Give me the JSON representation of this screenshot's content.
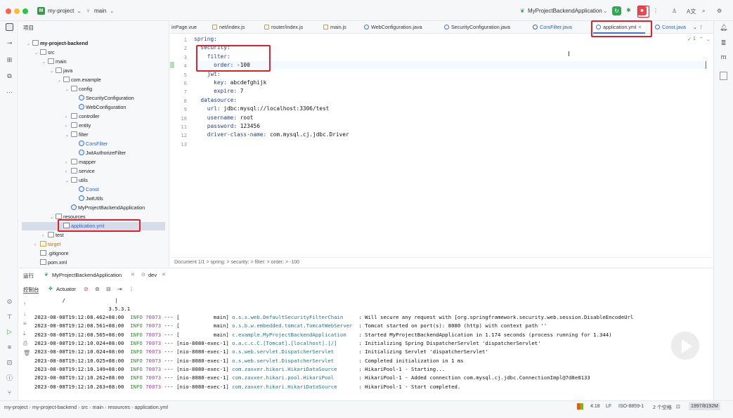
{
  "titlebar": {
    "project_badge": "M",
    "project_name": "my-project",
    "branch": "main",
    "run_config": "MyProjectBackendApplication"
  },
  "project_tree": {
    "header": "项目",
    "items": [
      {
        "label": "my-project-backend",
        "type": "folder",
        "bold": true
      },
      {
        "label": "src",
        "type": "folder"
      },
      {
        "label": "main",
        "type": "folder"
      },
      {
        "label": "java",
        "type": "folder"
      },
      {
        "label": "com.example",
        "type": "package"
      },
      {
        "label": "config",
        "type": "package"
      },
      {
        "label": "SecurityConfiguration",
        "type": "class"
      },
      {
        "label": "WebConfiguration",
        "type": "class"
      },
      {
        "label": "controller",
        "type": "package"
      },
      {
        "label": "entity",
        "type": "package"
      },
      {
        "label": "filter",
        "type": "package"
      },
      {
        "label": "CorsFilter",
        "type": "class"
      },
      {
        "label": "JwtAuthorizeFilter",
        "type": "class"
      },
      {
        "label": "mapper",
        "type": "package"
      },
      {
        "label": "service",
        "type": "package"
      },
      {
        "label": "utils",
        "type": "package"
      },
      {
        "label": "Const",
        "type": "class"
      },
      {
        "label": "JwtUtils",
        "type": "class"
      },
      {
        "label": "MyProjectBackendApplication",
        "type": "class"
      },
      {
        "label": "resources",
        "type": "folder"
      },
      {
        "label": "application.yml",
        "type": "yml"
      },
      {
        "label": "test",
        "type": "folder"
      },
      {
        "label": "target",
        "type": "folder"
      },
      {
        "label": ".gitignore",
        "type": "file"
      },
      {
        "label": "pom.xml",
        "type": "file"
      }
    ]
  },
  "tabs": [
    "inPage.vue",
    "net/index.js",
    "router/index.js",
    "main.js",
    "WebConfiguration.java",
    "SecurityConfiguration.java",
    "CorsFilter.java",
    "application.yml",
    "Const.java"
  ],
  "editor": {
    "lines": [
      {
        "n": "1",
        "key": "spring:",
        "val": ""
      },
      {
        "n": "2",
        "key": "  security:",
        "val": ""
      },
      {
        "n": "3",
        "key": "    filter:",
        "val": ""
      },
      {
        "n": "4",
        "key": "      order:",
        "val": " -100"
      },
      {
        "n": "5",
        "key": "    jwt:",
        "val": ""
      },
      {
        "n": "6",
        "key": "      key:",
        "val": " abcdefghijk"
      },
      {
        "n": "7",
        "key": "      expire:",
        "val": " 7"
      },
      {
        "n": "8",
        "key": "  datasource:",
        "val": ""
      },
      {
        "n": "9",
        "key": "    url:",
        "val": " jdbc:mysql://localhost:3306/test"
      },
      {
        "n": "10",
        "key": "    username:",
        "val": " root"
      },
      {
        "n": "11",
        "key": "    password:",
        "val": " 123456"
      },
      {
        "n": "12",
        "key": "    driver-class-name:",
        "val": " com.mysql.cj.jdbc.Driver"
      },
      {
        "n": "13",
        "key": "",
        "val": ""
      }
    ],
    "inspection": "1",
    "breadcrumb": "Document 1/1  >  spring:  >  security:  >  filter:  >  order:  >  -100"
  },
  "run": {
    "label": "运行",
    "tab1": "MyProjectBackendApplication",
    "tab2": "dev",
    "console_tab": "控制台",
    "actuator_tab": "Actuator",
    "banner1": "         /                |",
    "banner2": "                        3.5.3.1",
    "logs": [
      {
        "ts": "2023-08-08T19:12:08.462+08:00",
        "lvl": "INFO",
        "pid": "70073",
        "th": "--- [           main]",
        "logger": "o.s.s.web.DefaultSecurityFilterChain    ",
        "msg": " : Will secure any request with [org.springframework.security.web.session.DisableEncodeUrl"
      },
      {
        "ts": "2023-08-08T19:12:08.561+08:00",
        "lvl": "INFO",
        "pid": "70073",
        "th": "--- [           main]",
        "logger": "o.s.b.w.embedded.tomcat.TomcatWebServer ",
        "msg": " : Tomcat started on port(s): 8080 (http) with context path ''"
      },
      {
        "ts": "2023-08-08T19:12:08.565+08:00",
        "lvl": "INFO",
        "pid": "70073",
        "th": "--- [           main]",
        "logger": "c.example.MyProjectBackendApplication   ",
        "msg": " : Started MyProjectBackendApplication in 1.174 seconds (process running for 1.344)"
      },
      {
        "ts": "2023-08-08T19:12:10.024+08:00",
        "lvl": "INFO",
        "pid": "70073",
        "th": "--- [nio-8080-exec-1]",
        "logger": "o.a.c.c.C.[Tomcat].[localhost].[/]      ",
        "msg": " : Initializing Spring DispatcherServlet 'dispatcherServlet'"
      },
      {
        "ts": "2023-08-08T19:12:10.024+08:00",
        "lvl": "INFO",
        "pid": "70073",
        "th": "--- [nio-8080-exec-1]",
        "logger": "o.s.web.servlet.DispatcherServlet       ",
        "msg": " : Initializing Servlet 'dispatcherServlet'"
      },
      {
        "ts": "2023-08-08T19:12:10.025+08:00",
        "lvl": "INFO",
        "pid": "70073",
        "th": "--- [nio-8080-exec-1]",
        "logger": "o.s.web.servlet.DispatcherServlet       ",
        "msg": " : Completed initialization in 1 ms"
      },
      {
        "ts": "2023-08-08T19:12:10.149+08:00",
        "lvl": "INFO",
        "pid": "70073",
        "th": "--- [nio-8080-exec-1]",
        "logger": "com.zaxxer.hikari.HikariDataSource      ",
        "msg": " : HikariPool-1 - Starting..."
      },
      {
        "ts": "2023-08-08T19:12:10.262+08:00",
        "lvl": "INFO",
        "pid": "70073",
        "th": "--- [nio-8080-exec-1]",
        "logger": "com.zaxxer.hikari.pool.HikariPool       ",
        "msg": " : HikariPool-1 - Added connection com.mysql.cj.jdbc.ConnectionImpl@7d8e0133"
      },
      {
        "ts": "2023-08-08T19:12:10.263+08:00",
        "lvl": "INFO",
        "pid": "70073",
        "th": "--- [nio-8080-exec-1]",
        "logger": "com.zaxxer.hikari.HikariDataSource      ",
        "msg": " : HikariPool-1 - Start completed."
      }
    ]
  },
  "statusbar": {
    "crumbs": [
      "my-project",
      "my-project-backend",
      "src",
      "main",
      "resources",
      "application.yml"
    ],
    "position": "4:18",
    "line_sep": "LF",
    "encoding": "ISO-8859-1",
    "indent": "2 个空格",
    "memory": "1997/8192M"
  },
  "colors": {
    "accent": "#3b72d6",
    "highlight_box": "#e0202a",
    "run_green": "#2fa84f",
    "stop_red": "#e5484d"
  }
}
